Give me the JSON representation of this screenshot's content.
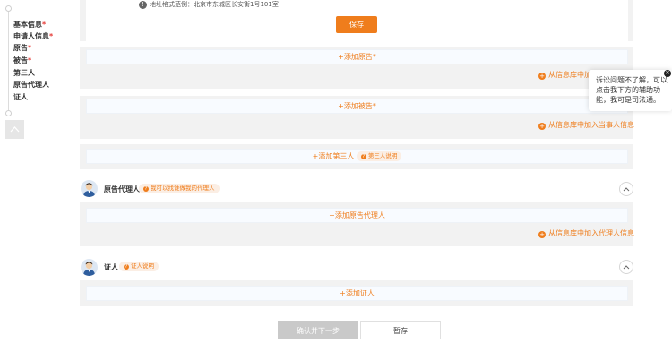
{
  "nav": {
    "items": [
      {
        "label": "基本信息",
        "required": "*"
      },
      {
        "label": "申请人信息",
        "required": "*"
      },
      {
        "label": "原告",
        "required": "*"
      },
      {
        "label": "被告",
        "required": "*"
      },
      {
        "label": "第三人",
        "required": ""
      },
      {
        "label": "原告代理人",
        "required": ""
      },
      {
        "label": "证人",
        "required": ""
      }
    ]
  },
  "address": {
    "hint": "地址格式范例：北京市东城区长安街1号101室"
  },
  "actions": {
    "save": "保存",
    "confirm_next": "确认并下一步",
    "draft": "暂存"
  },
  "plaintiff": {
    "add": "+添加原告*",
    "library": "从信息库中加入当事人信息"
  },
  "defendant": {
    "add": "+添加被告*",
    "library": "从信息库中加入当事人信息"
  },
  "third_party": {
    "add": "+添加第三人",
    "hint": "第三人说明"
  },
  "agent": {
    "title": "原告代理人",
    "hint": "我可以找谁做我的代理人",
    "add": "+添加原告代理人",
    "library": "从信息库中加入代理人信息"
  },
  "witness": {
    "title": "证人",
    "hint": "证人说明",
    "add": "+添加证人"
  },
  "assistant": {
    "text": "诉讼问题不了解，可以点击我下方的辅助功能，我可是司法通。"
  },
  "colors": {
    "accent": "#ef7d1c",
    "required": "#e53935",
    "panel": "#f2f2f2"
  }
}
